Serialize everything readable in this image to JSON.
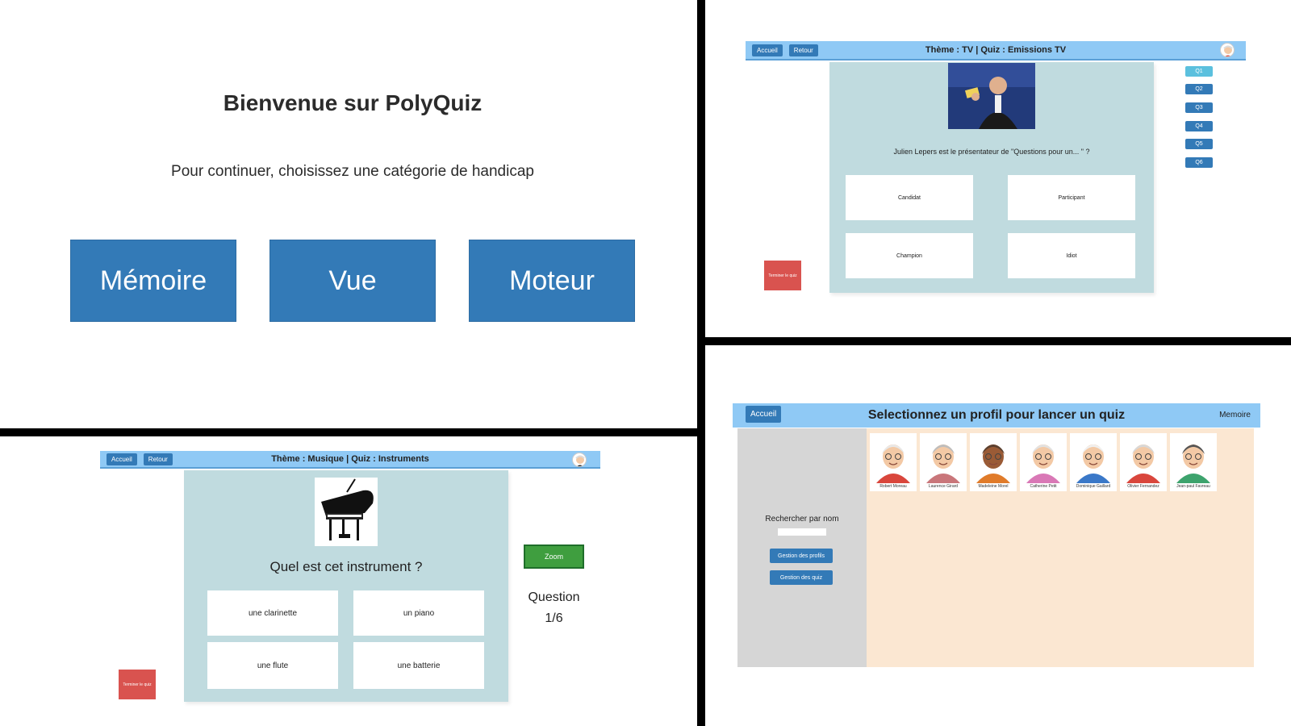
{
  "welcome": {
    "title": "Bienvenue sur PolyQuiz",
    "subtitle": "Pour continuer, choisissez une catégorie de handicap",
    "categories": [
      "Mémoire",
      "Vue",
      "Moteur"
    ]
  },
  "tv_quiz": {
    "home_label": "Accueil",
    "back_label": "Retour",
    "header_title": "Thème : TV | Quiz : Emissions TV",
    "question": "Julien Lepers est le présentateur de \"Questions pour un... \" ?",
    "answers": [
      "Candidat",
      "Participant",
      "Champion",
      "Idiot"
    ],
    "question_nav": [
      "Q1",
      "Q2",
      "Q3",
      "Q4",
      "Q5",
      "Q6"
    ],
    "end_label": "Terminer le quiz"
  },
  "music_quiz": {
    "home_label": "Accueil",
    "back_label": "Retour",
    "header_title": "Thème : Musique | Quiz : Instruments",
    "question": "Quel est cet instrument ?",
    "answers": [
      "une clarinette",
      "un piano",
      "une flute",
      "une batterie"
    ],
    "zoom_label": "Zoom",
    "counter_label": "Question",
    "counter_value": "1/6",
    "end_label": "Terminer le quiz"
  },
  "profiles": {
    "home_label": "Accueil",
    "title": "Selectionnez un profil pour lancer un quiz",
    "mode": "Memoire",
    "search_label": "Rechercher par nom",
    "manage_profiles": "Gestion des profils",
    "manage_quizzes": "Gestion des quiz",
    "list": [
      {
        "name": "Robert Moreau",
        "hair": "#e8e8e8",
        "shirt": "#d9463c",
        "skin": "#f3c9a5"
      },
      {
        "name": "Laurence Girard",
        "hair": "#bdbdbd",
        "shirt": "#c9767a",
        "skin": "#f3c9a5"
      },
      {
        "name": "Madeleine Morel",
        "hair": "#5a4030",
        "shirt": "#e07b2a",
        "skin": "#9a5b36"
      },
      {
        "name": "Catherine Petit",
        "hair": "#e2e2e2",
        "shirt": "#d978b6",
        "skin": "#f3c9a5"
      },
      {
        "name": "Dominique Gaillard",
        "hair": "#f0f0f0",
        "shirt": "#3a78c8",
        "skin": "#f3c9a5"
      },
      {
        "name": "Olivier Fernandez",
        "hair": "#d8d8d8",
        "shirt": "#d9463c",
        "skin": "#f3c9a5"
      },
      {
        "name": "Jean-paul Favreau",
        "hair": "#555555",
        "shirt": "#3da36d",
        "skin": "#f3c9a5"
      }
    ]
  },
  "colors": {
    "primary": "#337ab7",
    "header": "#8fc9f5",
    "quiz_bg": "#c0dbdf",
    "danger": "#d9534f",
    "zoom": "#3f9e3f",
    "profiles_bg": "#fbe7d2",
    "sidebar_bg": "#d6d6d6"
  }
}
